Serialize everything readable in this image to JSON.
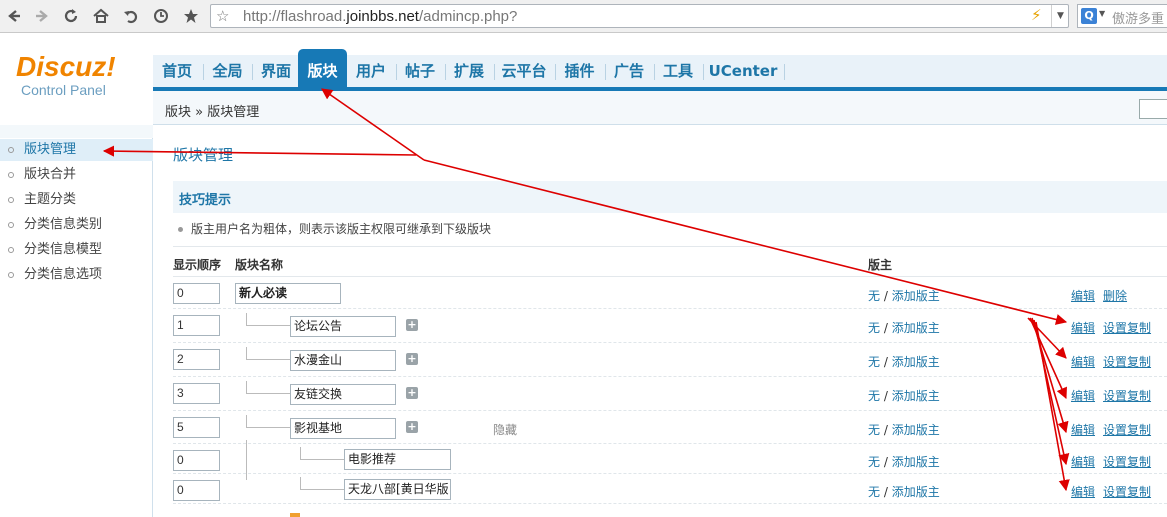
{
  "browser": {
    "url_prefix": "http://flashroad.",
    "url_host": "joinbbs.net",
    "url_suffix": "/admincp.php?",
    "search_placeholder": "傲游多重"
  },
  "logo": {
    "brand": "Discuz!",
    "subtitle": "Control Panel"
  },
  "nav": {
    "tabs": [
      "首页",
      "全局",
      "界面",
      "版块",
      "用户",
      "帖子",
      "扩展",
      "云平台",
      "插件",
      "广告",
      "工具",
      "UCenter"
    ],
    "active": "版块"
  },
  "breadcrumb": "版块 » 版块管理",
  "sidebar": {
    "items": [
      "版块管理",
      "版块合并",
      "主题分类",
      "分类信息类别",
      "分类信息模型",
      "分类信息选项"
    ],
    "active": "版块管理"
  },
  "main": {
    "title": "版块管理",
    "tip_title": "技巧提示",
    "tip_text": "版主用户名为粗体，则表示该版主权限可继承到下级版块",
    "columns": {
      "order": "显示顺序",
      "name": "版块名称",
      "moderator": "版主"
    },
    "rows": [
      {
        "order": "0",
        "name": "新人必读",
        "moderator": "无",
        "add_moderator": "添加版主",
        "ops": [
          "编辑",
          "删除"
        ],
        "hidden": ""
      },
      {
        "order": "1",
        "name": "论坛公告",
        "moderator": "无",
        "add_moderator": "添加版主",
        "ops": [
          "编辑",
          "设置复制"
        ],
        "hidden": ""
      },
      {
        "order": "2",
        "name": "水漫金山",
        "moderator": "无",
        "add_moderator": "添加版主",
        "ops": [
          "编辑",
          "设置复制"
        ],
        "hidden": ""
      },
      {
        "order": "3",
        "name": "友链交换",
        "moderator": "无",
        "add_moderator": "添加版主",
        "ops": [
          "编辑",
          "设置复制"
        ],
        "hidden": ""
      },
      {
        "order": "5",
        "name": "影视基地",
        "moderator": "无",
        "add_moderator": "添加版主",
        "ops": [
          "编辑",
          "设置复制"
        ],
        "hidden": "隐藏"
      },
      {
        "order": "0",
        "name": "电影推荐",
        "moderator": "无",
        "add_moderator": "添加版主",
        "ops": [
          "编辑",
          "设置复制"
        ],
        "hidden": ""
      },
      {
        "order": "0",
        "name": "天龙八部[黄日华版",
        "moderator": "无",
        "add_moderator": "添加版主",
        "ops": [
          "编辑",
          "设置复制"
        ],
        "hidden": ""
      }
    ]
  },
  "colors": {
    "accent": "#1779b6",
    "logo": "#f08400",
    "arrow": "#dd0000"
  }
}
